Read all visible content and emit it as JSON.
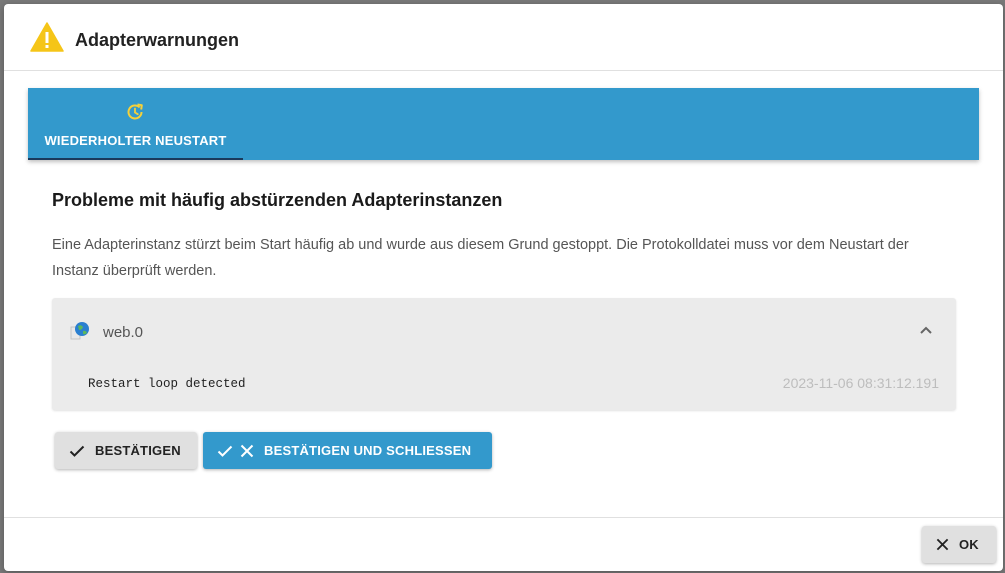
{
  "dialog": {
    "title": "Adapterwarnungen",
    "warning_icon": "warning-triangle-icon",
    "accent_color": "#3399cc"
  },
  "tabs": [
    {
      "label": "WIEDERHOLTER NEUSTART",
      "icon": "restart-clock-icon",
      "selected": true
    }
  ],
  "content": {
    "title": "Probleme mit häufig abstürzenden Adapterinstanzen",
    "description": "Eine Adapterinstanz stürzt beim Start häufig ab und wurde aus diesem Grund gestoppt. Die Protokolldatei muss vor dem Neustart der Instanz überprüft werden."
  },
  "instance": {
    "name": "web.0",
    "icon": "web-adapter-icon",
    "expanded": true,
    "message": "Restart loop detected",
    "timestamp": "2023-11-06 08:31:12.191"
  },
  "actions": {
    "confirm_label": "BESTÄTIGEN",
    "confirm_close_label": "BESTÄTIGEN UND SCHLIESSEN"
  },
  "footer": {
    "ok_label": "OK"
  }
}
